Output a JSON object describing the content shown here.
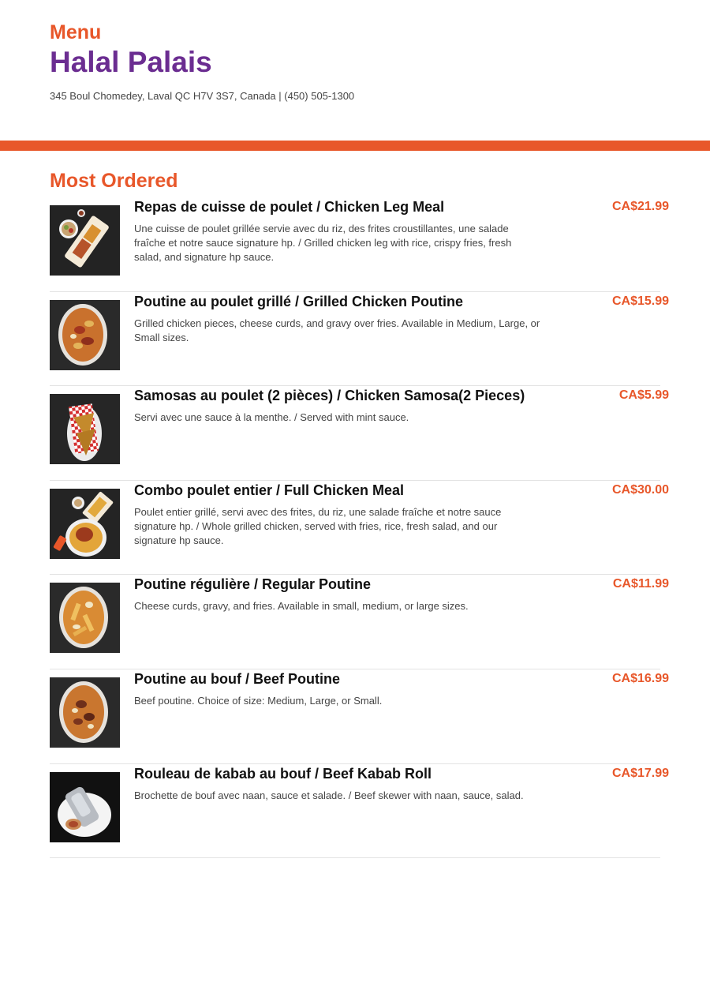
{
  "header": {
    "label": "Menu",
    "restaurant": "Halal Palais",
    "address": "345 Boul Chomedey, Laval QC H7V 3S7, Canada | (450) 505-1300"
  },
  "section": {
    "title": "Most Ordered"
  },
  "items": [
    {
      "name": "Repas de cuisse de poulet / Chicken Leg Meal",
      "description": "Une cuisse de poulet grillée servie avec du riz, des frites croustillantes, une salade fraîche et notre sauce signature hp. / Grilled chicken leg with rice, crispy fries, fresh salad, and signature hp sauce.",
      "price": "CA$21.99",
      "image": "chicken-leg-meal-photo"
    },
    {
      "name": "Poutine au poulet grillé / Grilled Chicken Poutine",
      "description": "Grilled chicken pieces, cheese curds, and gravy over fries. Available in Medium, Large, or Small sizes.",
      "price": "CA$15.99",
      "image": "chicken-poutine-photo"
    },
    {
      "name": "Samosas au poulet (2 pièces) / Chicken Samosa(2 Pieces)",
      "description": "Servi avec une sauce à la menthe. / Served with mint sauce.",
      "price": "CA$5.99",
      "image": "samosa-photo"
    },
    {
      "name": "Combo poulet entier / Full Chicken Meal",
      "description": "Poulet entier grillé, servi avec des frites, du riz, une salade fraîche et notre sauce signature hp. / Whole grilled chicken, served with fries, rice, fresh salad, and our signature hp sauce.",
      "price": "CA$30.00",
      "image": "full-chicken-meal-photo"
    },
    {
      "name": "Poutine régulière / Regular Poutine",
      "description": "Cheese curds, gravy, and fries. Available in small, medium, or large sizes.",
      "price": "CA$11.99",
      "image": "regular-poutine-photo"
    },
    {
      "name": "Poutine au bouf / Beef Poutine",
      "description": "Beef poutine. Choice of size: Medium, Large, or Small.",
      "price": "CA$16.99",
      "image": "beef-poutine-photo"
    },
    {
      "name": "Rouleau de kabab au bouf / Beef Kabab Roll",
      "description": "Brochette de bouf avec naan, sauce et salade. / Beef skewer with naan, sauce, salad.",
      "price": "CA$17.99",
      "image": "kabab-roll-photo"
    }
  ],
  "colors": {
    "accent": "#e8572a",
    "brand": "#6b2d91"
  }
}
